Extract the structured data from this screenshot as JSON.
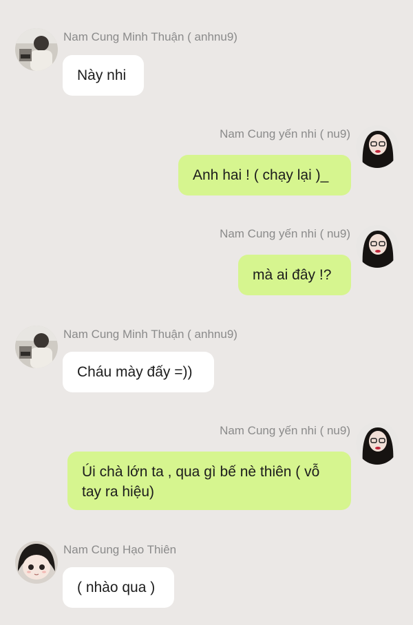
{
  "messages": [
    {
      "side": "left",
      "sender": "Nam Cung Minh Thuận ( anhnu9)",
      "text": "Này nhi",
      "avatar": "male-avatar"
    },
    {
      "side": "right",
      "sender": "Nam Cung yến nhi ( nu9)",
      "text": "Anh hai ! ( chạy lại )_",
      "avatar": "female-avatar"
    },
    {
      "side": "right",
      "sender": "Nam Cung yến nhi ( nu9)",
      "text": "mà ai đây !?",
      "avatar": "female-avatar"
    },
    {
      "side": "left",
      "sender": "Nam Cung Minh Thuận ( anhnu9)",
      "text": "Cháu mày đấy =))",
      "avatar": "male-avatar"
    },
    {
      "side": "right",
      "sender": "Nam Cung yến nhi ( nu9)",
      "text": "Úi chà lớn ta , qua gì bế nè thiên ( vỗ tay ra hiệu)",
      "avatar": "female-avatar"
    },
    {
      "side": "left",
      "sender": "Nam Cung Hạo Thiên",
      "text": "( nhào qua )",
      "avatar": "child-avatar"
    }
  ],
  "colors": {
    "background": "#ebe8e6",
    "incoming_bubble": "#ffffff",
    "outgoing_bubble": "#d6f58f",
    "sender_name": "#8a8a8a"
  }
}
